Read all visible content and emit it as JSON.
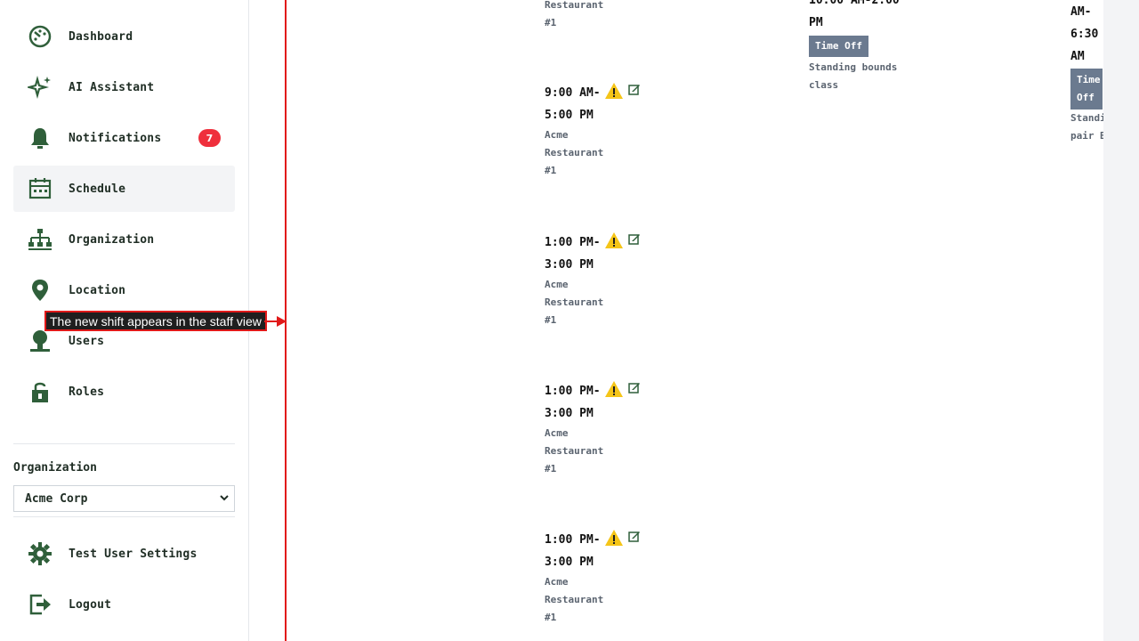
{
  "sidebar": {
    "items": [
      {
        "label": "Dashboard",
        "icon": "dashboard-icon"
      },
      {
        "label": "AI Assistant",
        "icon": "sparkle-icon"
      },
      {
        "label": "Notifications",
        "icon": "bell-icon",
        "badge": "7"
      },
      {
        "label": "Schedule",
        "icon": "calendar-icon",
        "active": true
      },
      {
        "label": "Organization",
        "icon": "org-chart-icon"
      },
      {
        "label": "Location",
        "icon": "location-pin-icon"
      },
      {
        "label": "Users",
        "icon": "user-icon"
      },
      {
        "label": "Roles",
        "icon": "lock-icon"
      }
    ],
    "organization": {
      "label": "Organization",
      "selected": "Acme Corp"
    },
    "footer": [
      {
        "label": "Test User Settings",
        "icon": "gear-icon"
      },
      {
        "label": "Logout",
        "icon": "logout-icon"
      }
    ]
  },
  "annotation": {
    "text": "The new shift appears in the staff view"
  },
  "schedule": {
    "column1": [
      {
        "loc_tail": [
          "Restaurant",
          "#1"
        ]
      },
      {
        "time": [
          "9:00 AM-",
          "5:00 PM"
        ],
        "loc": [
          "Acme",
          "Restaurant",
          "#1"
        ]
      },
      {
        "time": [
          "1:00 PM-",
          "3:00 PM"
        ],
        "loc": [
          "Acme",
          "Restaurant",
          "#1"
        ]
      },
      {
        "time": [
          "1:00 PM-",
          "3:00 PM"
        ],
        "loc": [
          "Acme",
          "Restaurant",
          "#1"
        ]
      },
      {
        "time": [
          "1:00 PM-",
          "3:00 PM"
        ],
        "loc": [
          "Acme",
          "Restaurant",
          "#1"
        ]
      }
    ],
    "column2": {
      "time": [
        "10:00 AM-2:00",
        "PM"
      ],
      "badge": "Time Off",
      "note": [
        "Standing bounds",
        "class"
      ]
    },
    "column3": {
      "time": [
        "AM-",
        "6:30",
        "AM"
      ],
      "badge": [
        "Time",
        "Off"
      ],
      "note": [
        "Standi",
        "pair B"
      ]
    }
  },
  "colors": {
    "accent": "#2f5f3a",
    "badge": "#ef2f3c",
    "timeoff": "#6b7a8f",
    "annotation_border": "#e11919",
    "warning": "#f5c518"
  }
}
